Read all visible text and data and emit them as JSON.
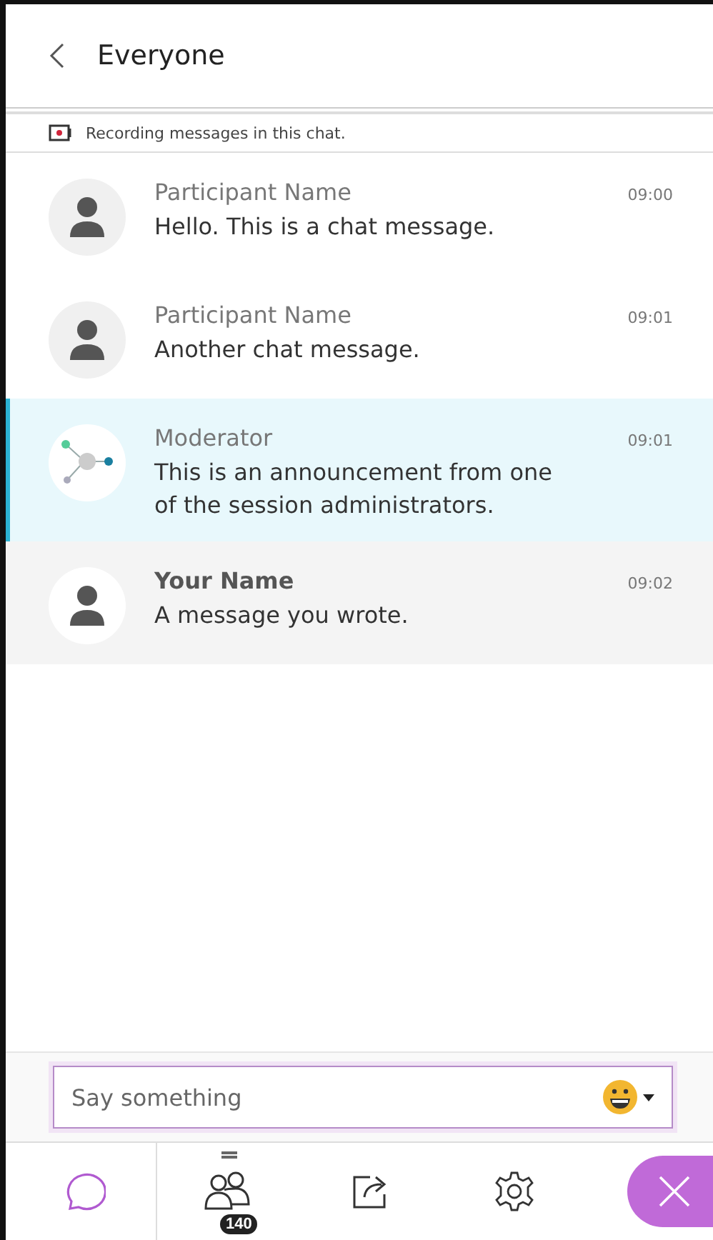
{
  "header": {
    "title": "Everyone"
  },
  "notice": {
    "text": "Recording messages in this chat."
  },
  "messages": [
    {
      "kind": "participant",
      "name": "Participant Name",
      "time": "09:00",
      "text": "Hello. This is a chat message."
    },
    {
      "kind": "participant",
      "name": "Participant Name",
      "time": "09:01",
      "text": "Another chat message."
    },
    {
      "kind": "moderator",
      "name": "Moderator",
      "time": "09:01",
      "text": "This is an announcement from one of the session administrators."
    },
    {
      "kind": "own",
      "name": "Your Name",
      "time": "09:02",
      "text": "A message you wrote."
    }
  ],
  "composer": {
    "placeholder": "Say something"
  },
  "nav": [
    {
      "kind": "chat",
      "selected": true
    },
    {
      "kind": "participants",
      "selected": false,
      "badge": "140"
    },
    {
      "kind": "share",
      "selected": false
    },
    {
      "kind": "settings",
      "selected": false
    },
    {
      "kind": "close",
      "selected": false
    }
  ]
}
